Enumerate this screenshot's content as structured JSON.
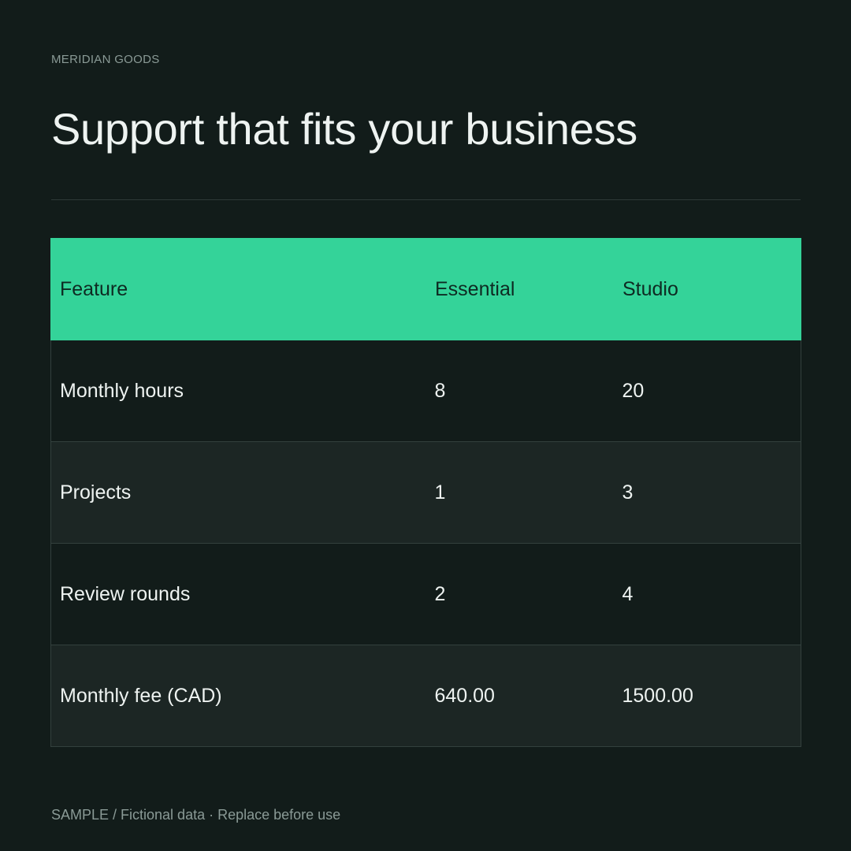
{
  "brand": "MERIDIAN GOODS",
  "title": "Support that fits your business",
  "table": {
    "headers": [
      "Feature",
      "Essential",
      "Studio"
    ],
    "rows": [
      [
        "Monthly hours",
        "8",
        "20"
      ],
      [
        "Projects",
        "1",
        "3"
      ],
      [
        "Review rounds",
        "2",
        "4"
      ],
      [
        "Monthly fee (CAD)",
        "640.00",
        "1500.00"
      ]
    ]
  },
  "footer": "SAMPLE / Fictional data · Replace before use",
  "colors": {
    "background": "#121c1a",
    "accent": "#34d399",
    "row_alt": "#1c2624"
  }
}
